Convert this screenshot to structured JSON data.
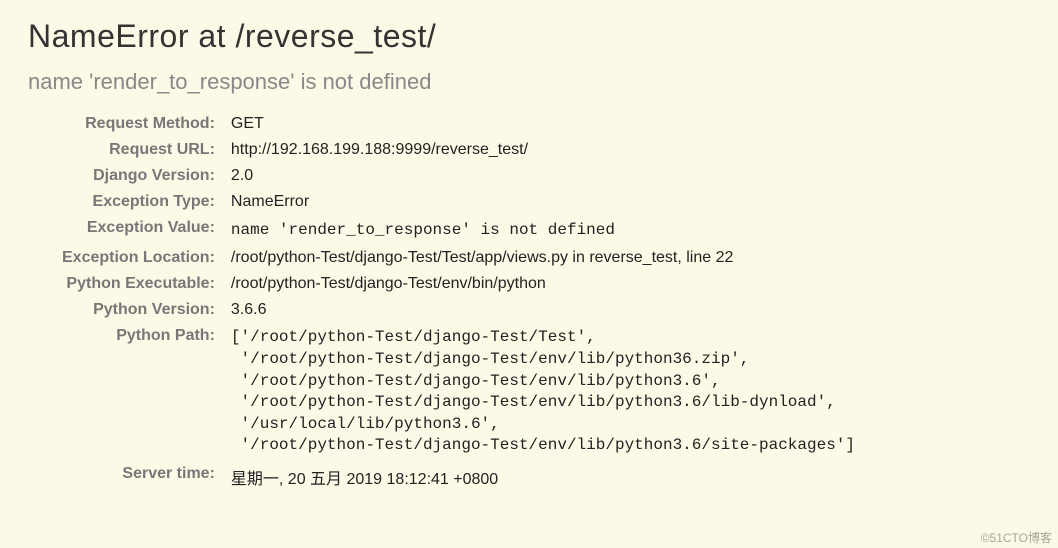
{
  "header": {
    "title": "NameError at /reverse_test/",
    "exception_message": "name 'render_to_response' is not defined"
  },
  "meta": {
    "request_method_label": "Request Method:",
    "request_method_value": "GET",
    "request_url_label": "Request URL:",
    "request_url_value": "http://192.168.199.188:9999/reverse_test/",
    "django_version_label": "Django Version:",
    "django_version_value": "2.0",
    "exception_type_label": "Exception Type:",
    "exception_type_value": "NameError",
    "exception_value_label": "Exception Value:",
    "exception_value_value": "name 'render_to_response' is not defined",
    "exception_location_label": "Exception Location:",
    "exception_location_value": "/root/python-Test/django-Test/Test/app/views.py in reverse_test, line 22",
    "python_executable_label": "Python Executable:",
    "python_executable_value": "/root/python-Test/django-Test/env/bin/python",
    "python_version_label": "Python Version:",
    "python_version_value": "3.6.6",
    "python_path_label": "Python Path:",
    "python_path_value": "['/root/python-Test/django-Test/Test',\n '/root/python-Test/django-Test/env/lib/python36.zip',\n '/root/python-Test/django-Test/env/lib/python3.6',\n '/root/python-Test/django-Test/env/lib/python3.6/lib-dynload',\n '/usr/local/lib/python3.6',\n '/root/python-Test/django-Test/env/lib/python3.6/site-packages']",
    "server_time_label": "Server time:",
    "server_time_value": "星期一, 20 五月 2019 18:12:41 +0800"
  },
  "watermark": "©51CTO博客"
}
